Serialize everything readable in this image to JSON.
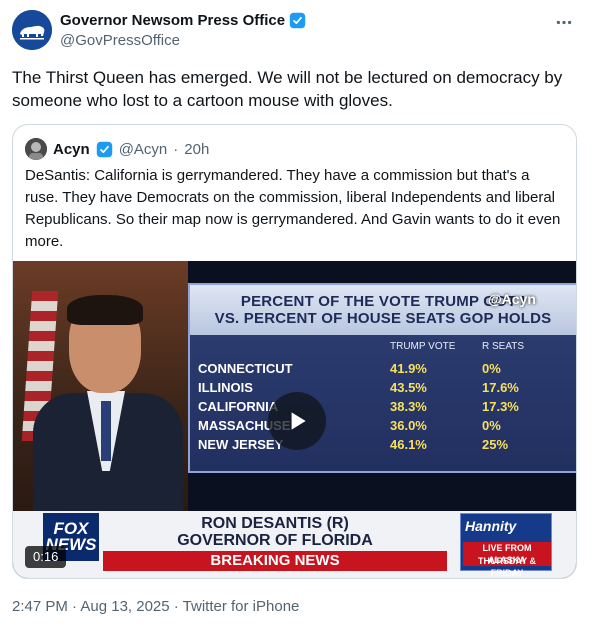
{
  "tweet": {
    "display_name": "Governor Newsom Press Office",
    "handle": "@GovPressOffice",
    "more_icon": "more-horizontal-icon",
    "text": "The Thirst Queen has emerged. We will not be lectured on democracy by someone who lost to a cartoon mouse with gloves.",
    "footer": "2:47 PM · Aug 13, 2025 · Twitter for iPhone",
    "colors": {
      "verified": "#1d9bf0",
      "secondary_text": "#536471",
      "avatar_bg": "#17499b"
    }
  },
  "quote": {
    "display_name": "Acyn",
    "handle": "@Acyn",
    "separator": "·",
    "time": "20h",
    "text": "DeSantis: California is gerrymandered. They have a commission but that's a ruse. They have Democrats on the commission, liberal Independents and liberal Republicans. So their map now is gerrymandered. And Gavin wants to do it even more.",
    "video": {
      "timestamp": "0:16",
      "graphic": {
        "title_line1": "PERCENT OF THE VOTE TRUMP GOT I",
        "title_line2": "VS. PERCENT OF HOUSE SEATS GOP HOLDS",
        "watermark": "@Acyn",
        "col1_header": "TRUMP VOTE",
        "col2_header": "R SEATS",
        "rows": [
          {
            "state": "CONNECTICUT",
            "trump_vote": "41.9%",
            "r_seats": "0%"
          },
          {
            "state": "ILLINOIS",
            "trump_vote": "43.5%",
            "r_seats": "17.6%"
          },
          {
            "state": "CALIFORNIA",
            "trump_vote": "38.3%",
            "r_seats": "17.3%"
          },
          {
            "state": "MASSACHUSE",
            "trump_vote": "36.0%",
            "r_seats": "0%"
          },
          {
            "state": "NEW JERSEY",
            "trump_vote": "46.1%",
            "r_seats": "25%"
          }
        ]
      },
      "lower_third": {
        "logo_line1": "FOX",
        "logo_line2": "NEWS",
        "name_line1": "RON DESANTIS (R)",
        "name_line2": "GOVERNOR OF FLORIDA",
        "breaking": "BREAKING NEWS",
        "show_logo": "Hannity",
        "show_live": "LIVE FROM ALASKA",
        "show_day": "THURSDAY & FRIDAY"
      }
    }
  }
}
